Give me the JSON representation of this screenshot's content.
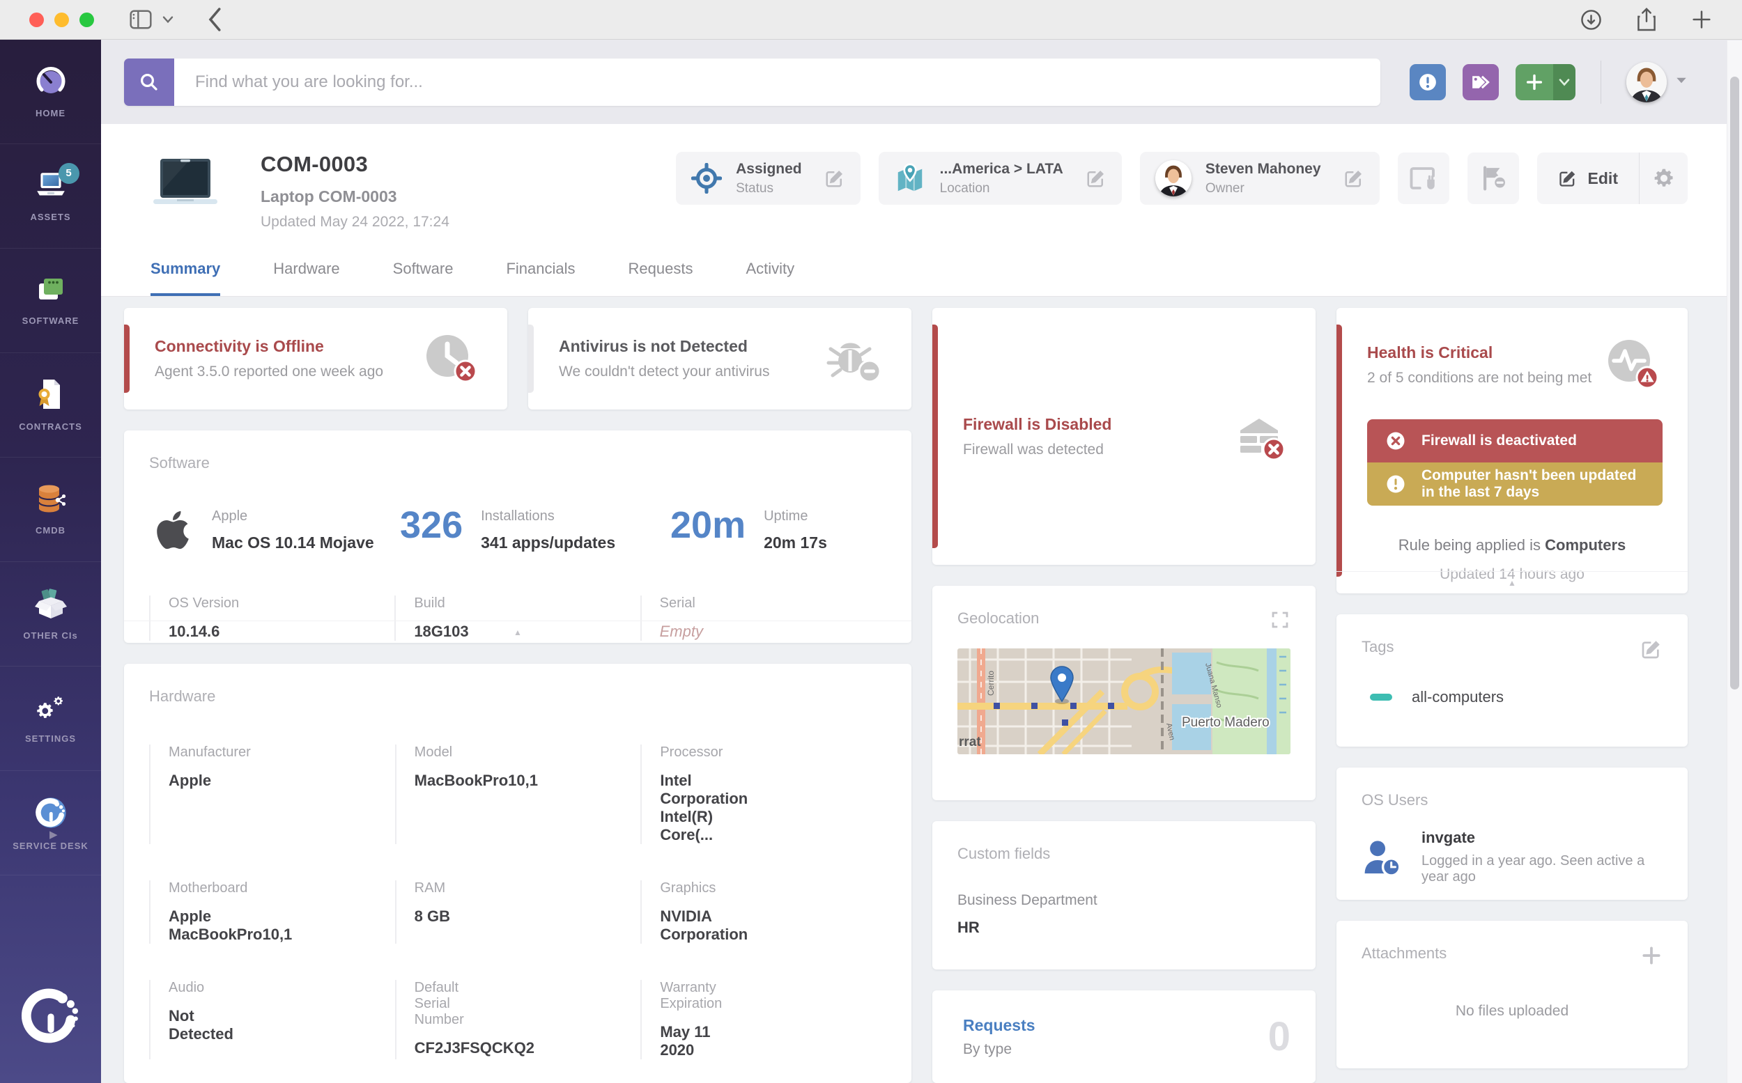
{
  "topbar": {
    "search_placeholder": "Find what you are looking for..."
  },
  "sidebar": {
    "items": [
      {
        "label": "HOME"
      },
      {
        "label": "ASSETS",
        "badge": "5"
      },
      {
        "label": "SOFTWARE"
      },
      {
        "label": "CONTRACTS"
      },
      {
        "label": "CMDB"
      },
      {
        "label": "OTHER CIs"
      },
      {
        "label": "SETTINGS"
      },
      {
        "label": "SERVICE DESK"
      }
    ]
  },
  "header": {
    "title": "COM-0003",
    "subtitle": "Laptop COM-0003",
    "updated": "Updated May 24 2022, 17:24",
    "status": {
      "value": "Assigned",
      "label": "Status"
    },
    "location": {
      "value": "...America > LATA",
      "label": "Location"
    },
    "owner": {
      "value": "Steven Mahoney",
      "label": "Owner"
    },
    "edit_label": "Edit"
  },
  "tabs": {
    "items": [
      "Summary",
      "Hardware",
      "Software",
      "Financials",
      "Requests",
      "Activity"
    ],
    "active": "Summary"
  },
  "alerts": [
    {
      "title": "Connectivity is Offline",
      "subtitle": "Agent 3.5.0 reported one week ago",
      "severity": "critical",
      "icon": "clock-offline-icon"
    },
    {
      "title": "Antivirus is not Detected",
      "subtitle": "We couldn't detect your antivirus",
      "severity": "neutral",
      "icon": "antivirus-bug-icon"
    },
    {
      "title": "Firewall is Disabled",
      "subtitle": "Firewall was detected",
      "severity": "critical",
      "icon": "firewall-icon"
    }
  ],
  "health": {
    "title": "Health is Critical",
    "subtitle": "2 of 5 conditions are not being met",
    "conditions": [
      {
        "text": "Firewall is deactivated",
        "level": "error"
      },
      {
        "text": "Computer hasn't been updated in the last 7 days",
        "level": "warning"
      }
    ],
    "rule_prefix": "Rule being applied is ",
    "rule_name": "Computers",
    "updated": "Updated 14 hours ago"
  },
  "software": {
    "section_title": "Software",
    "vendor_label": "Apple",
    "os_name": "Mac OS 10.14 Mojave",
    "installations": {
      "value": "326",
      "label": "Installations",
      "detail": "341 apps/updates"
    },
    "uptime": {
      "value": "20m",
      "label": "Uptime",
      "detail": "20m 17s"
    },
    "fields": [
      {
        "label": "OS Version",
        "value": "10.14.6"
      },
      {
        "label": "Build",
        "value": "18G103"
      },
      {
        "label": "Serial",
        "value": "Empty"
      }
    ]
  },
  "geolocation": {
    "title": "Geolocation",
    "map_labels": {
      "street_left": "Cerrito",
      "area_left": "rrat",
      "district": "Puerto Madero",
      "street_right": "Juana Manso",
      "avenue": "Aven"
    }
  },
  "custom_fields": {
    "title": "Custom fields",
    "fields": [
      {
        "label": "Business Department",
        "value": "HR"
      }
    ]
  },
  "requests": {
    "title": "Requests",
    "subtitle": "By type",
    "count": "0"
  },
  "hardware": {
    "section_title": "Hardware",
    "fields": [
      {
        "label": "Manufacturer",
        "value": "Apple"
      },
      {
        "label": "Model",
        "value": "MacBookPro10,1"
      },
      {
        "label": "Processor",
        "value": "Intel Corporation Intel(R) Core(..."
      },
      {
        "label": "Motherboard",
        "value": "Apple MacBookPro10,1"
      },
      {
        "label": "RAM",
        "value": "8 GB"
      },
      {
        "label": "Graphics",
        "value": "NVIDIA Corporation"
      },
      {
        "label": "Audio",
        "value": "Not Detected"
      },
      {
        "label": "Default Serial Number",
        "value": "CF2J3FSQCKQ2"
      },
      {
        "label": "Warranty Expiration",
        "value": "May 11 2020"
      }
    ]
  },
  "tags": {
    "title": "Tags",
    "items": [
      {
        "name": "all-computers",
        "color": "#3dbdb2"
      }
    ]
  },
  "os_users": {
    "title": "OS Users",
    "users": [
      {
        "name": "invgate",
        "detail": "Logged in a year ago. Seen active a year ago"
      }
    ]
  },
  "attachments": {
    "title": "Attachments",
    "empty_text": "No files uploaded"
  },
  "colors": {
    "accent_blue": "#3f6fb5",
    "critical_red": "#b34b4b",
    "warning_gold": "#c9aa55",
    "tag_teal": "#3dbdb2",
    "brand_purple": "#7a6fbb",
    "add_green": "#61a165"
  }
}
